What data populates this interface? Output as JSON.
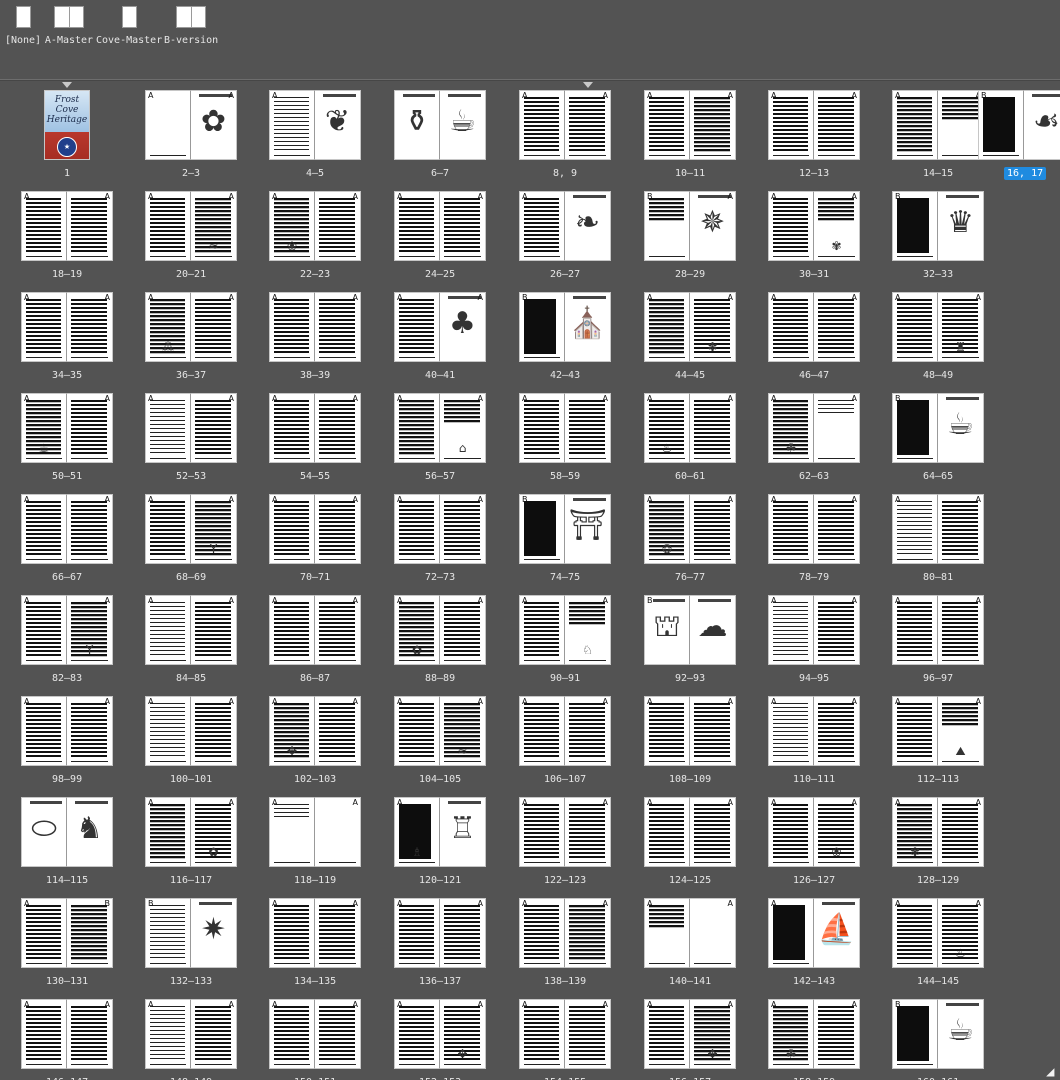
{
  "masters": [
    {
      "label": "[None]",
      "kind": "single"
    },
    {
      "label": "A-Master",
      "kind": "spread"
    },
    {
      "label": "Cove-Master",
      "kind": "single"
    },
    {
      "label": "B-version",
      "kind": "spread"
    }
  ],
  "cover": {
    "title_line1": "Frost Cove",
    "title_line2": "Heritage"
  },
  "rows": [
    [
      {
        "label": "1",
        "single": true,
        "cover": true,
        "tri": true
      },
      {
        "label": "2–3",
        "l": "A",
        "r": "A",
        "lt": "blank",
        "rt": "illus",
        "ri": "✿"
      },
      {
        "label": "4–5",
        "l": "A",
        "r": "",
        "lt": "light",
        "rt": "illus",
        "ri": "❦",
        "li": "☘"
      },
      {
        "label": "6–7",
        "l": "",
        "r": "",
        "lt": "illus",
        "rt": "illus",
        "li": "⚱",
        "ri": "☕",
        "spanIllus": true
      },
      {
        "label": "8, 9",
        "l": "A",
        "r": "A",
        "lt": "text",
        "rt": "text",
        "tri": true
      },
      {
        "label": "10–11",
        "l": "A",
        "r": "A",
        "lt": "text",
        "rt": "mid"
      },
      {
        "label": "12–13",
        "l": "A",
        "r": "A",
        "lt": "text",
        "rt": "text"
      },
      {
        "label": "14–15",
        "l": "A",
        "r": "A",
        "lt": "mid",
        "rt": "half"
      },
      {
        "label": "16, 17",
        "l": "B",
        "r": "",
        "lt": "solid",
        "rt": "illus",
        "ri": "☙",
        "sel": true,
        "tri": true,
        "clip": true
      }
    ],
    [
      {
        "label": "18–19",
        "l": "A",
        "r": "A",
        "lt": "text",
        "rt": "text"
      },
      {
        "label": "20–21",
        "l": "A",
        "r": "A",
        "lt": "text",
        "rt": "mid",
        "ri2": "≈"
      },
      {
        "label": "22–23",
        "l": "A",
        "r": "A",
        "lt": "mid",
        "rt": "text",
        "li2": "❀"
      },
      {
        "label": "24–25",
        "l": "A",
        "r": "A",
        "lt": "text",
        "rt": "text"
      },
      {
        "label": "26–27",
        "l": "A",
        "r": "",
        "lt": "text",
        "rt": "illus",
        "ri": "❧"
      },
      {
        "label": "28–29",
        "l": "B",
        "r": "A",
        "lt": "half",
        "rt": "illus",
        "ri": "✵"
      },
      {
        "label": "30–31",
        "l": "A",
        "r": "A",
        "lt": "text",
        "rt": "half",
        "ri2": "✾"
      },
      {
        "label": "32–33",
        "l": "B",
        "r": "",
        "lt": "solid",
        "rt": "illus",
        "ri": "♛"
      }
    ],
    [
      {
        "label": "34–35",
        "l": "A",
        "r": "A",
        "lt": "text",
        "rt": "text"
      },
      {
        "label": "36–37",
        "l": "A",
        "r": "A",
        "lt": "mid",
        "rt": "text",
        "li2": "⁂"
      },
      {
        "label": "38–39",
        "l": "A",
        "r": "A",
        "lt": "text",
        "rt": "text"
      },
      {
        "label": "40–41",
        "l": "A",
        "r": "A",
        "lt": "text",
        "rt": "illus",
        "ri": "♣"
      },
      {
        "label": "42–43",
        "l": "B",
        "r": "",
        "lt": "solid",
        "rt": "illus",
        "ri": "⛪"
      },
      {
        "label": "44–45",
        "l": "A",
        "r": "A",
        "lt": "mid",
        "rt": "text",
        "ri2": "✽"
      },
      {
        "label": "46–47",
        "l": "A",
        "r": "A",
        "lt": "text",
        "rt": "text"
      },
      {
        "label": "48–49",
        "l": "A",
        "r": "A",
        "lt": "text",
        "rt": "text",
        "ri2": "♜"
      }
    ],
    [
      {
        "label": "50–51",
        "l": "A",
        "r": "A",
        "lt": "mid",
        "rt": "text",
        "li2": "☕"
      },
      {
        "label": "52–53",
        "l": "A",
        "r": "A",
        "lt": "light",
        "rt": "text"
      },
      {
        "label": "54–55",
        "l": "A",
        "r": "A",
        "lt": "text",
        "rt": "text"
      },
      {
        "label": "56–57",
        "l": "A",
        "r": "A",
        "lt": "mid",
        "rt": "half",
        "ri2": "⌂"
      },
      {
        "label": "58–59",
        "l": "A",
        "r": "A",
        "lt": "text",
        "rt": "text"
      },
      {
        "label": "60–61",
        "l": "A",
        "r": "A",
        "lt": "text",
        "rt": "text",
        "li2": "♨"
      },
      {
        "label": "62–63",
        "l": "A",
        "r": "A",
        "lt": "mid",
        "rt": "top",
        "li2": "☘"
      },
      {
        "label": "64–65",
        "l": "B",
        "r": "",
        "lt": "solid",
        "rt": "illus",
        "ri": "☕"
      }
    ],
    [
      {
        "label": "66–67",
        "l": "A",
        "r": "A",
        "lt": "text",
        "rt": "text"
      },
      {
        "label": "68–69",
        "l": "A",
        "r": "A",
        "lt": "text",
        "rt": "mid",
        "ri2": "Y"
      },
      {
        "label": "70–71",
        "l": "A",
        "r": "A",
        "lt": "text",
        "rt": "text"
      },
      {
        "label": "72–73",
        "l": "A",
        "r": "A",
        "lt": "text",
        "rt": "text"
      },
      {
        "label": "74–75",
        "l": "B",
        "r": "",
        "lt": "solid",
        "rt": "illus",
        "ri": "⛩"
      },
      {
        "label": "76–77",
        "l": "A",
        "r": "A",
        "lt": "mid",
        "rt": "text",
        "li2": "❂"
      },
      {
        "label": "78–79",
        "l": "A",
        "r": "A",
        "lt": "text",
        "rt": "text"
      },
      {
        "label": "80–81",
        "l": "A",
        "r": "A",
        "lt": "light",
        "rt": "text"
      }
    ],
    [
      {
        "label": "82–83",
        "l": "A",
        "r": "A",
        "lt": "text",
        "rt": "mid",
        "ri2": "Y"
      },
      {
        "label": "84–85",
        "l": "A",
        "r": "A",
        "lt": "light",
        "rt": "text"
      },
      {
        "label": "86–87",
        "l": "A",
        "r": "A",
        "lt": "text",
        "rt": "text"
      },
      {
        "label": "88–89",
        "l": "A",
        "r": "A",
        "lt": "mid",
        "rt": "text",
        "li2": "✿"
      },
      {
        "label": "90–91",
        "l": "A",
        "r": "A",
        "lt": "text",
        "rt": "half",
        "ri2": "♘"
      },
      {
        "label": "92–93",
        "l": "B",
        "r": "",
        "lt": "illus",
        "rt": "illus",
        "li": "⛫",
        "ri": "☁"
      },
      {
        "label": "94–95",
        "l": "A",
        "r": "A",
        "lt": "light",
        "rt": "text"
      },
      {
        "label": "96–97",
        "l": "A",
        "r": "A",
        "lt": "text",
        "rt": "text"
      }
    ],
    [
      {
        "label": "98–99",
        "l": "A",
        "r": "A",
        "lt": "text",
        "rt": "text"
      },
      {
        "label": "100–101",
        "l": "A",
        "r": "A",
        "lt": "light",
        "rt": "text"
      },
      {
        "label": "102–103",
        "l": "A",
        "r": "A",
        "lt": "mid",
        "rt": "text",
        "li2": "✥"
      },
      {
        "label": "104–105",
        "l": "A",
        "r": "A",
        "lt": "text",
        "rt": "mid",
        "ri2": "≈"
      },
      {
        "label": "106–107",
        "l": "A",
        "r": "A",
        "lt": "text",
        "rt": "text"
      },
      {
        "label": "108–109",
        "l": "A",
        "r": "A",
        "lt": "text",
        "rt": "text"
      },
      {
        "label": "110–111",
        "l": "A",
        "r": "A",
        "lt": "light",
        "rt": "text"
      },
      {
        "label": "112–113",
        "l": "A",
        "r": "A",
        "lt": "text",
        "rt": "half",
        "ri2": "⛰"
      }
    ],
    [
      {
        "label": "114–115",
        "l": "",
        "r": "",
        "lt": "illus",
        "rt": "illus",
        "li": "⬭",
        "ri": "♞"
      },
      {
        "label": "116–117",
        "l": "A",
        "r": "A",
        "lt": "mid",
        "rt": "text",
        "ri2": "✿"
      },
      {
        "label": "118–119",
        "l": "A",
        "r": "A",
        "lt": "top",
        "rt": "blank"
      },
      {
        "label": "120–121",
        "l": "A",
        "r": "",
        "lt": "solid",
        "rt": "illus",
        "ri": "♖",
        "li2": "♗"
      },
      {
        "label": "122–123",
        "l": "A",
        "r": "A",
        "lt": "text",
        "rt": "text"
      },
      {
        "label": "124–125",
        "l": "A",
        "r": "A",
        "lt": "text",
        "rt": "text"
      },
      {
        "label": "126–127",
        "l": "A",
        "r": "A",
        "lt": "text",
        "rt": "text",
        "ri2": "❀"
      },
      {
        "label": "128–129",
        "l": "A",
        "r": "A",
        "lt": "mid",
        "rt": "text",
        "li2": "✾"
      }
    ],
    [
      {
        "label": "130–131",
        "l": "A",
        "r": "B",
        "lt": "text",
        "rt": "mid"
      },
      {
        "label": "132–133",
        "l": "B",
        "r": "",
        "lt": "light",
        "rt": "illus",
        "ri": "✷"
      },
      {
        "label": "134–135",
        "l": "A",
        "r": "A",
        "lt": "text",
        "rt": "text"
      },
      {
        "label": "136–137",
        "l": "A",
        "r": "A",
        "lt": "text",
        "rt": "text"
      },
      {
        "label": "138–139",
        "l": "A",
        "r": "A",
        "lt": "text",
        "rt": "mid"
      },
      {
        "label": "140–141",
        "l": "A",
        "r": "A",
        "lt": "half",
        "rt": "blank"
      },
      {
        "label": "142–143",
        "l": "A",
        "r": "",
        "lt": "solid",
        "rt": "illus",
        "ri": "⛵"
      },
      {
        "label": "144–145",
        "l": "A",
        "r": "A",
        "lt": "text",
        "rt": "text",
        "ri2": "♨"
      }
    ],
    [
      {
        "label": "146–147",
        "l": "A",
        "r": "A",
        "lt": "text",
        "rt": "text"
      },
      {
        "label": "148–149",
        "l": "A",
        "r": "A",
        "lt": "light",
        "rt": "text"
      },
      {
        "label": "150–151",
        "l": "A",
        "r": "A",
        "lt": "text",
        "rt": "text"
      },
      {
        "label": "152–153",
        "l": "A",
        "r": "A",
        "lt": "text",
        "rt": "text",
        "ri2": "✥"
      },
      {
        "label": "154–155",
        "l": "A",
        "r": "A",
        "lt": "text",
        "rt": "text"
      },
      {
        "label": "156–157",
        "l": "A",
        "r": "A",
        "lt": "text",
        "rt": "mid",
        "ri2": "✥"
      },
      {
        "label": "158–159",
        "l": "A",
        "r": "A",
        "lt": "mid",
        "rt": "text",
        "li2": "☘"
      },
      {
        "label": "160–161",
        "l": "B",
        "r": "",
        "lt": "solid",
        "rt": "illus",
        "ri": "☕"
      }
    ]
  ],
  "colors": {
    "panel_bg": "#535353",
    "selection": "#1f8be0",
    "label": "#e6e6e6"
  }
}
